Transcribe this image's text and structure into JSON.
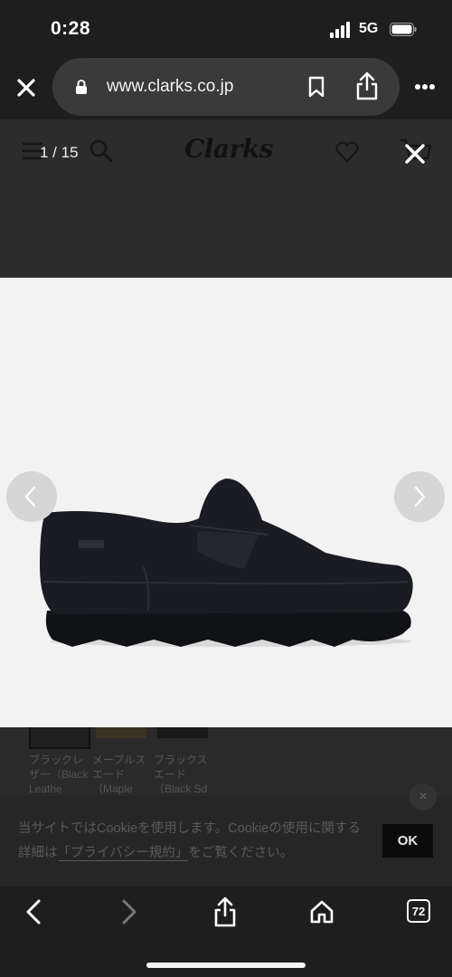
{
  "status_bar": {
    "time": "0:28",
    "network": "5G"
  },
  "browser": {
    "url": "www.clarks.co.jp",
    "tab_count": "72"
  },
  "site": {
    "logo_text": "Clarks"
  },
  "gallery": {
    "counter": "1 / 15"
  },
  "swatches": [
    {
      "label": "ブラックレザー（Black Leathe"
    },
    {
      "label": "メープルスエード（Maple Sued"
    },
    {
      "label": "ブラックスエード（Black Sd"
    }
  ],
  "cookie": {
    "text_before": "当サイトではCookieを使用します。Cookieの使用に関する詳細は",
    "link_text": "「プライバシー規約」",
    "text_after": "をご覧ください。",
    "ok_label": "OK"
  },
  "colors": {
    "backdrop": "#2a2a2a",
    "image_bg": "#f2f2f2",
    "shoe": "#15171c"
  }
}
